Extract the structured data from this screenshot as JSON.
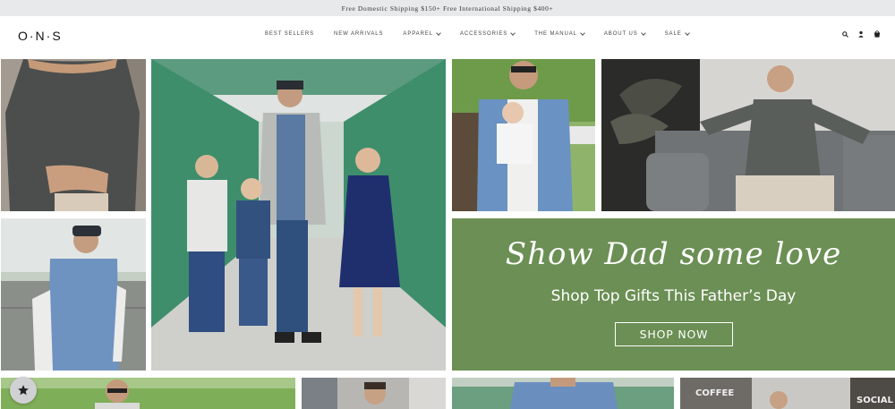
{
  "announcement": {
    "text": "Free Domestic Shipping $150+ Free International Shipping $400+"
  },
  "header": {
    "logo": "O·N·S",
    "nav": [
      {
        "label": "BEST SELLERS",
        "dropdown": false
      },
      {
        "label": "NEW ARRIVALS",
        "dropdown": false
      },
      {
        "label": "APPAREL",
        "dropdown": true
      },
      {
        "label": "ACCESSORIES",
        "dropdown": true
      },
      {
        "label": "THE MANUAL",
        "dropdown": true
      },
      {
        "label": "ABOUT US",
        "dropdown": true
      },
      {
        "label": "SALE",
        "dropdown": true
      }
    ],
    "utility_icons": [
      "search-icon",
      "account-icon",
      "cart-icon"
    ]
  },
  "promo": {
    "headline": "Show Dad some love",
    "subheadline": "Shop Top Gifts This Father’s Day",
    "button_label": "SHOP NOW",
    "background_color": "#6b8f54"
  },
  "tiles": [
    {
      "name": "man-gray-shirt-photo"
    },
    {
      "name": "family-bridge-photo"
    },
    {
      "name": "man-holding-baby-photo"
    },
    {
      "name": "man-sofa-photo"
    },
    {
      "name": "man-cap-fence-photo"
    },
    {
      "name": "man-outdoor-sunglasses-photo"
    },
    {
      "name": "man-house-photo"
    },
    {
      "name": "man-blue-shirt-photo"
    },
    {
      "name": "storefront-photo"
    }
  ],
  "storefront_signs": [
    "COFFEE",
    "SOCIAL"
  ],
  "favorite_button": {
    "icon": "star-icon"
  }
}
